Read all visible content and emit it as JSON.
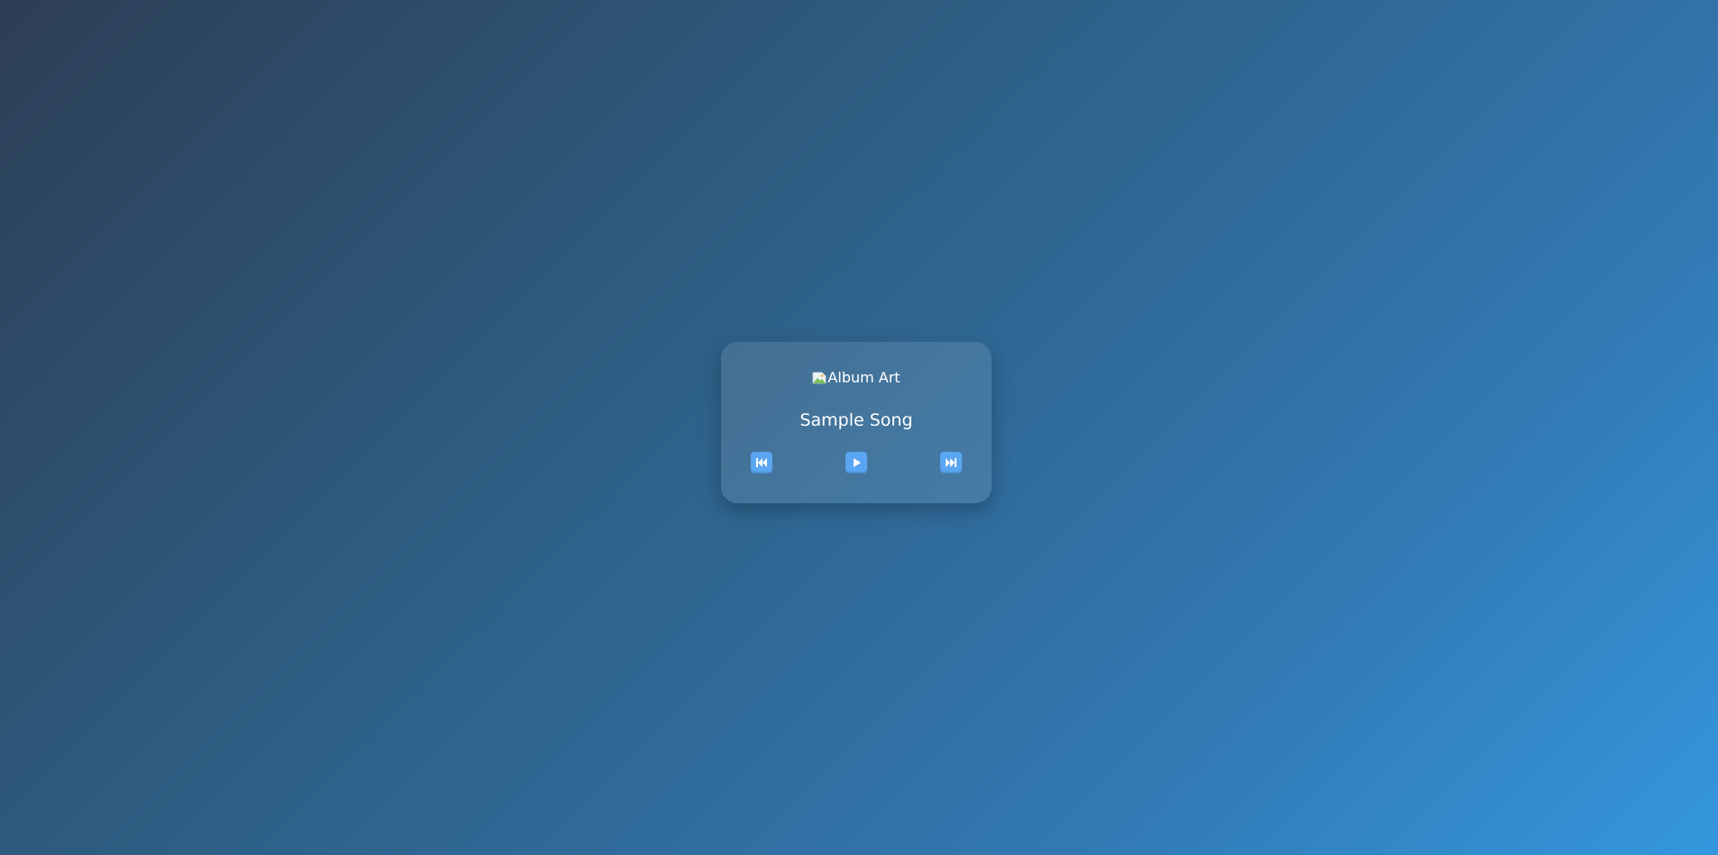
{
  "player": {
    "album_art_alt": "Album Art",
    "song_title": "Sample Song",
    "controls": {
      "previous_icon": "previous-track-icon",
      "play_icon": "play-icon",
      "next_icon": "next-track-icon"
    }
  },
  "colors": {
    "background_start": "#2d3e55",
    "background_end": "#3497dd",
    "button_fill": "#5aa6f2",
    "text": "#ffffff"
  }
}
